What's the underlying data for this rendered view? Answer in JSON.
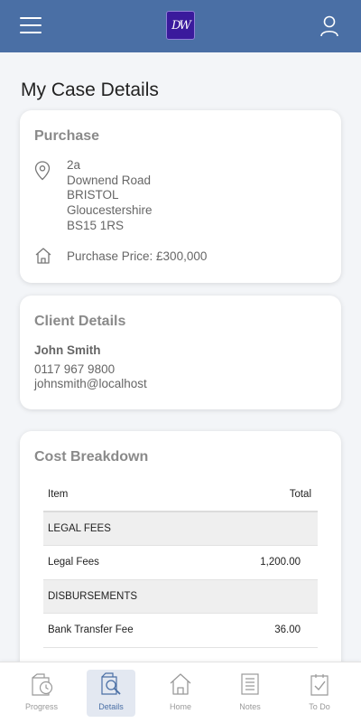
{
  "header": {
    "logo_text": "DW"
  },
  "page_title": "My Case Details",
  "purchase": {
    "title": "Purchase",
    "address": [
      "2a",
      "Downend Road",
      "BRISTOL",
      "Gloucestershire",
      "BS15 1RS"
    ],
    "price_label": "Purchase Price: £300,000"
  },
  "client": {
    "title": "Client Details",
    "name": "John Smith",
    "phone": "0117 967 9800",
    "email": "johnsmith@localhost"
  },
  "costs": {
    "title": "Cost Breakdown",
    "col_item": "Item",
    "col_total": "Total",
    "rows": [
      {
        "kind": "section",
        "item": "LEGAL FEES",
        "total": ""
      },
      {
        "kind": "item",
        "item": "Legal Fees",
        "total": "1,200.00"
      },
      {
        "kind": "section",
        "item": "DISBURSEMENTS",
        "total": ""
      },
      {
        "kind": "item",
        "item": "Bank Transfer Fee",
        "total": "36.00"
      }
    ]
  },
  "nav": {
    "tabs": [
      {
        "label": "Progress",
        "icon": "progress-icon"
      },
      {
        "label": "Details",
        "icon": "details-icon",
        "active": true
      },
      {
        "label": "Home",
        "icon": "home-icon"
      },
      {
        "label": "Notes",
        "icon": "notes-icon"
      },
      {
        "label": "To Do",
        "icon": "todo-icon"
      }
    ]
  },
  "colors": {
    "header": "#4a6fa5",
    "logo": "#3a1a9c",
    "active_tab_bg": "#e3e8f1"
  }
}
